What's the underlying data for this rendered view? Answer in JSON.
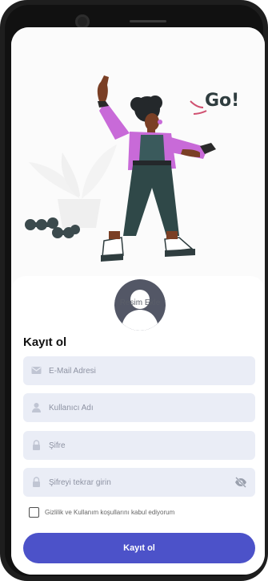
{
  "illustration": {
    "speech": "Go!"
  },
  "avatar": {
    "label": "Resim Ekle"
  },
  "form": {
    "title": "Kayıt ol",
    "email": {
      "placeholder": "E-Mail Adresi",
      "value": ""
    },
    "username": {
      "placeholder": "Kullanıcı Adı",
      "value": ""
    },
    "password": {
      "placeholder": "Şifre",
      "value": ""
    },
    "password_repeat": {
      "placeholder": "Şifreyi tekrar girin",
      "value": ""
    },
    "terms_label": "Gizlilik ve Kullanım koşullarını kabul ediyorum",
    "terms_checked": false,
    "submit_label": "Kayıt ol"
  },
  "colors": {
    "accent": "#4c52c9",
    "field_bg": "#eaedf6",
    "avatar": "#535766",
    "illustration_top": "#c86ad8",
    "illustration_pants": "#2f4848"
  }
}
